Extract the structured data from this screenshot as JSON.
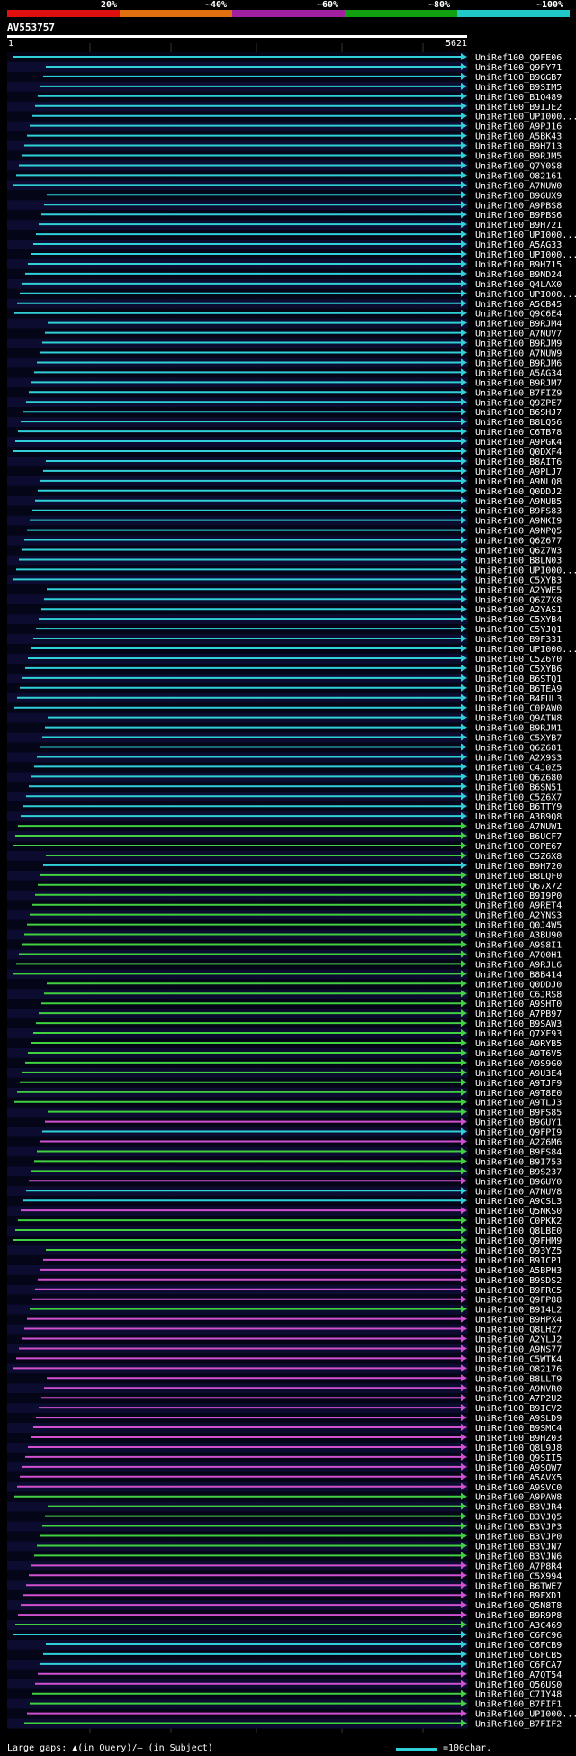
{
  "legend": {
    "labels": [
      "20%",
      "~40%",
      "~60%",
      "~80%",
      "~100%"
    ],
    "colors": [
      "#e01010",
      "#e07010",
      "#a020a0",
      "#10a010",
      "#20c8c8"
    ]
  },
  "query": {
    "name": "AV553757",
    "start": "1",
    "end": "5621"
  },
  "palette": {
    "cyan": "#2fd0d8",
    "green": "#40d040",
    "magenta": "#d050d0",
    "row_a": "#050518",
    "row_b": "#0c0c30",
    "grid": "#333"
  },
  "hits": [
    {
      "label": "UniRef100_Q9FE06",
      "c": "c"
    },
    {
      "label": "UniRef100_Q9FY71",
      "c": "c"
    },
    {
      "label": "UniRef100_B9GGB7",
      "c": "c"
    },
    {
      "label": "UniRef100_B9SIM5",
      "c": "c"
    },
    {
      "label": "UniRef100_B1Q489",
      "c": "c"
    },
    {
      "label": "UniRef100_B9IJE2",
      "c": "c"
    },
    {
      "label": "UniRef100_UPI000...",
      "c": "c"
    },
    {
      "label": "UniRef100_A9PJ16",
      "c": "c"
    },
    {
      "label": "UniRef100_A5BK43",
      "c": "c"
    },
    {
      "label": "UniRef100_B9H713",
      "c": "c"
    },
    {
      "label": "UniRef100_B9RJM5",
      "c": "c"
    },
    {
      "label": "UniRef100_Q7Y0S8",
      "c": "c"
    },
    {
      "label": "UniRef100_O82161",
      "c": "c"
    },
    {
      "label": "UniRef100_A7NUW0",
      "c": "c"
    },
    {
      "label": "UniRef100_B9GUX9",
      "c": "c"
    },
    {
      "label": "UniRef100_A9PBS8",
      "c": "c"
    },
    {
      "label": "UniRef100_B9PBS6",
      "c": "c"
    },
    {
      "label": "UniRef100_B9H721",
      "c": "c"
    },
    {
      "label": "UniRef100_UPI000...",
      "c": "c"
    },
    {
      "label": "UniRef100_A5AG33",
      "c": "c"
    },
    {
      "label": "UniRef100_UPI000...",
      "c": "c"
    },
    {
      "label": "UniRef100_B9H715",
      "c": "c"
    },
    {
      "label": "UniRef100_B9ND24",
      "c": "c"
    },
    {
      "label": "UniRef100_Q4LAX0",
      "c": "c"
    },
    {
      "label": "UniRef100_UPI000...",
      "c": "c"
    },
    {
      "label": "UniRef100_A5CB45",
      "c": "c"
    },
    {
      "label": "UniRef100_Q9C6E4",
      "c": "c"
    },
    {
      "label": "UniRef100_B9RJM4",
      "c": "c"
    },
    {
      "label": "UniRef100_A7NUV7",
      "c": "c"
    },
    {
      "label": "UniRef100_B9RJM9",
      "c": "c"
    },
    {
      "label": "UniRef100_A7NUW9",
      "c": "c"
    },
    {
      "label": "UniRef100_B9RJM6",
      "c": "c"
    },
    {
      "label": "UniRef100_A5AG34",
      "c": "c"
    },
    {
      "label": "UniRef100_B9RJM7",
      "c": "c"
    },
    {
      "label": "UniRef100_B7FIZ9",
      "c": "c"
    },
    {
      "label": "UniRef100_Q9ZPE7",
      "c": "c"
    },
    {
      "label": "UniRef100_B6SHJ7",
      "c": "c"
    },
    {
      "label": "UniRef100_B8LQ56",
      "c": "c"
    },
    {
      "label": "UniRef100_C6TB78",
      "c": "c"
    },
    {
      "label": "UniRef100_A9PGK4",
      "c": "c"
    },
    {
      "label": "UniRef100_Q0DXF4",
      "c": "c"
    },
    {
      "label": "UniRef100_B8AIT6",
      "c": "c"
    },
    {
      "label": "UniRef100_A9PLJ7",
      "c": "c"
    },
    {
      "label": "UniRef100_A9NLQ8",
      "c": "c"
    },
    {
      "label": "UniRef100_Q0DDJ2",
      "c": "c"
    },
    {
      "label": "UniRef100_A9NUB5",
      "c": "c"
    },
    {
      "label": "UniRef100_B9FS83",
      "c": "c"
    },
    {
      "label": "UniRef100_A9NKI9",
      "c": "c"
    },
    {
      "label": "UniRef100_A9NPQ5",
      "c": "c"
    },
    {
      "label": "UniRef100_Q6Z677",
      "c": "c"
    },
    {
      "label": "UniRef100_Q6Z7W3",
      "c": "c"
    },
    {
      "label": "UniRef100_B8LN03",
      "c": "c"
    },
    {
      "label": "UniRef100_UPI000...",
      "c": "c"
    },
    {
      "label": "UniRef100_C5XYB3",
      "c": "c"
    },
    {
      "label": "UniRef100_A2YWE5",
      "c": "c"
    },
    {
      "label": "UniRef100_Q6Z7X8",
      "c": "c"
    },
    {
      "label": "UniRef100_A2YAS1",
      "c": "c"
    },
    {
      "label": "UniRef100_C5XYB4",
      "c": "c"
    },
    {
      "label": "UniRef100_C5YJQ1",
      "c": "c"
    },
    {
      "label": "UniRef100_B9F331",
      "c": "c"
    },
    {
      "label": "UniRef100_UPI000...",
      "c": "c"
    },
    {
      "label": "UniRef100_C5Z6Y0",
      "c": "c"
    },
    {
      "label": "UniRef100_C5XYB6",
      "c": "c"
    },
    {
      "label": "UniRef100_B6STQ1",
      "c": "c"
    },
    {
      "label": "UniRef100_B6TEA9",
      "c": "c"
    },
    {
      "label": "UniRef100_B4FUL3",
      "c": "c"
    },
    {
      "label": "UniRef100_C0PAW0",
      "c": "c"
    },
    {
      "label": "UniRef100_Q9ATN8",
      "c": "c"
    },
    {
      "label": "UniRef100_B9RJM1",
      "c": "c"
    },
    {
      "label": "UniRef100_C5XYB7",
      "c": "c"
    },
    {
      "label": "UniRef100_Q6Z681",
      "c": "c"
    },
    {
      "label": "UniRef100_A2X9S3",
      "c": "c"
    },
    {
      "label": "UniRef100_C4J0Z5",
      "c": "c"
    },
    {
      "label": "UniRef100_Q6Z680",
      "c": "c"
    },
    {
      "label": "UniRef100_B6SN51",
      "c": "c"
    },
    {
      "label": "UniRef100_C5Z6X7",
      "c": "c"
    },
    {
      "label": "UniRef100_B6TTY9",
      "c": "c"
    },
    {
      "label": "UniRef100_A3B9Q8",
      "c": "c"
    },
    {
      "label": "UniRef100_A7NUW1",
      "c": "g"
    },
    {
      "label": "UniRef100_B6UCF7",
      "c": "g"
    },
    {
      "label": "UniRef100_C0PE67",
      "c": "g"
    },
    {
      "label": "UniRef100_C5Z6X8",
      "c": "g"
    },
    {
      "label": "UniRef100_B9H720",
      "c": "c"
    },
    {
      "label": "UniRef100_B8LQF0",
      "c": "g"
    },
    {
      "label": "UniRef100_Q67X72",
      "c": "g"
    },
    {
      "label": "UniRef100_B9I9P0",
      "c": "g"
    },
    {
      "label": "UniRef100_A9RET4",
      "c": "g"
    },
    {
      "label": "UniRef100_A2YNS3",
      "c": "g"
    },
    {
      "label": "UniRef100_Q0J4W5",
      "c": "g"
    },
    {
      "label": "UniRef100_A3BU90",
      "c": "g"
    },
    {
      "label": "UniRef100_A9S8I1",
      "c": "g"
    },
    {
      "label": "UniRef100_A7Q0H1",
      "c": "g"
    },
    {
      "label": "UniRef100_A9RJL6",
      "c": "g"
    },
    {
      "label": "UniRef100_B8B414",
      "c": "g"
    },
    {
      "label": "UniRef100_Q0DDJ0",
      "c": "g"
    },
    {
      "label": "UniRef100_C6JRS8",
      "c": "g"
    },
    {
      "label": "UniRef100_A9SHT0",
      "c": "g"
    },
    {
      "label": "UniRef100_A7PB97",
      "c": "g"
    },
    {
      "label": "UniRef100_B9SAW3",
      "c": "g"
    },
    {
      "label": "UniRef100_Q7XF93",
      "c": "g"
    },
    {
      "label": "UniRef100_A9RYB5",
      "c": "g"
    },
    {
      "label": "UniRef100_A9T6V5",
      "c": "g"
    },
    {
      "label": "UniRef100_A9S9G0",
      "c": "g"
    },
    {
      "label": "UniRef100_A9U3E4",
      "c": "g"
    },
    {
      "label": "UniRef100_A9TJF9",
      "c": "g"
    },
    {
      "label": "UniRef100_A9T8E0",
      "c": "g"
    },
    {
      "label": "UniRef100_A9TLJ3",
      "c": "g"
    },
    {
      "label": "UniRef100_B9FS85",
      "c": "g"
    },
    {
      "label": "UniRef100_B9GUY1",
      "c": "m"
    },
    {
      "label": "UniRef100_Q9FPI9",
      "c": "c"
    },
    {
      "label": "UniRef100_A2Z6M6",
      "c": "m"
    },
    {
      "label": "UniRef100_B9FS84",
      "c": "g"
    },
    {
      "label": "UniRef100_B9I753",
      "c": "g"
    },
    {
      "label": "UniRef100_B9S237",
      "c": "g"
    },
    {
      "label": "UniRef100_B9GUY0",
      "c": "m"
    },
    {
      "label": "UniRef100_A7NUV8",
      "c": "c"
    },
    {
      "label": "UniRef100_A9CSL3",
      "c": "c"
    },
    {
      "label": "UniRef100_Q5NKS0",
      "c": "m"
    },
    {
      "label": "UniRef100_C0PKK2",
      "c": "g"
    },
    {
      "label": "UniRef100_Q8LBE0",
      "c": "g"
    },
    {
      "label": "UniRef100_Q9FHM9",
      "c": "g"
    },
    {
      "label": "UniRef100_Q93YZ5",
      "c": "g"
    },
    {
      "label": "UniRef100_B9ICP1",
      "c": "m"
    },
    {
      "label": "UniRef100_A5BPH3",
      "c": "m"
    },
    {
      "label": "UniRef100_B9SDS2",
      "c": "m"
    },
    {
      "label": "UniRef100_B9FRC5",
      "c": "m"
    },
    {
      "label": "UniRef100_Q9FP88",
      "c": "m"
    },
    {
      "label": "UniRef100_B9I4L2",
      "c": "g"
    },
    {
      "label": "UniRef100_B9HPX4",
      "c": "m"
    },
    {
      "label": "UniRef100_Q8LHZ7",
      "c": "m"
    },
    {
      "label": "UniRef100_A2YLJ2",
      "c": "m"
    },
    {
      "label": "UniRef100_A9NS77",
      "c": "m"
    },
    {
      "label": "UniRef100_C5WTK4",
      "c": "m"
    },
    {
      "label": "UniRef100_O82176",
      "c": "m"
    },
    {
      "label": "UniRef100_B8LLT9",
      "c": "m"
    },
    {
      "label": "UniRef100_A9NVR0",
      "c": "m"
    },
    {
      "label": "UniRef100_A7P2U2",
      "c": "m"
    },
    {
      "label": "UniRef100_B9ICV2",
      "c": "m"
    },
    {
      "label": "UniRef100_A9SLD9",
      "c": "m"
    },
    {
      "label": "UniRef100_B9SMC4",
      "c": "m"
    },
    {
      "label": "UniRef100_B9HZ03",
      "c": "m"
    },
    {
      "label": "UniRef100_Q8L9J8",
      "c": "m"
    },
    {
      "label": "UniRef100_Q9SII5",
      "c": "m"
    },
    {
      "label": "UniRef100_A9SQW7",
      "c": "m"
    },
    {
      "label": "UniRef100_A5AVX5",
      "c": "m"
    },
    {
      "label": "UniRef100_A9SVC0",
      "c": "m"
    },
    {
      "label": "UniRef100_A9PAW8",
      "c": "g"
    },
    {
      "label": "UniRef100_B3VJR4",
      "c": "g"
    },
    {
      "label": "UniRef100_B3VJQ5",
      "c": "g"
    },
    {
      "label": "UniRef100_B3VJP3",
      "c": "g"
    },
    {
      "label": "UniRef100_B3VJP0",
      "c": "g"
    },
    {
      "label": "UniRef100_B3VJN7",
      "c": "g"
    },
    {
      "label": "UniRef100_B3VJN6",
      "c": "g"
    },
    {
      "label": "UniRef100_A7P8R4",
      "c": "m"
    },
    {
      "label": "UniRef100_C5X994",
      "c": "m"
    },
    {
      "label": "UniRef100_B6TWE7",
      "c": "m"
    },
    {
      "label": "UniRef100_B9FXD1",
      "c": "m"
    },
    {
      "label": "UniRef100_Q5N8T8",
      "c": "m"
    },
    {
      "label": "UniRef100_B9R9P8",
      "c": "m"
    },
    {
      "label": "UniRef100_A3C469",
      "c": "g"
    },
    {
      "label": "UniRef100_C6FC96",
      "c": "c"
    },
    {
      "label": "UniRef100_C6FCB9",
      "c": "c"
    },
    {
      "label": "UniRef100_C6FCB5",
      "c": "c"
    },
    {
      "label": "UniRef100_C6FCA7",
      "c": "c"
    },
    {
      "label": "UniRef100_A7QT54",
      "c": "m"
    },
    {
      "label": "UniRef100_Q56US0",
      "c": "m"
    },
    {
      "label": "UniRef100_C7IY48",
      "c": "g"
    },
    {
      "label": "UniRef100_B7FIF1",
      "c": "g"
    },
    {
      "label": "UniRef100_UPI000...",
      "c": "m"
    },
    {
      "label": "UniRef100_B7FIF2",
      "c": "g"
    }
  ],
  "footer": {
    "gaps_note": "Large gaps: ▲(in Query)/– (in Subject)",
    "scale_note": "=100char."
  }
}
